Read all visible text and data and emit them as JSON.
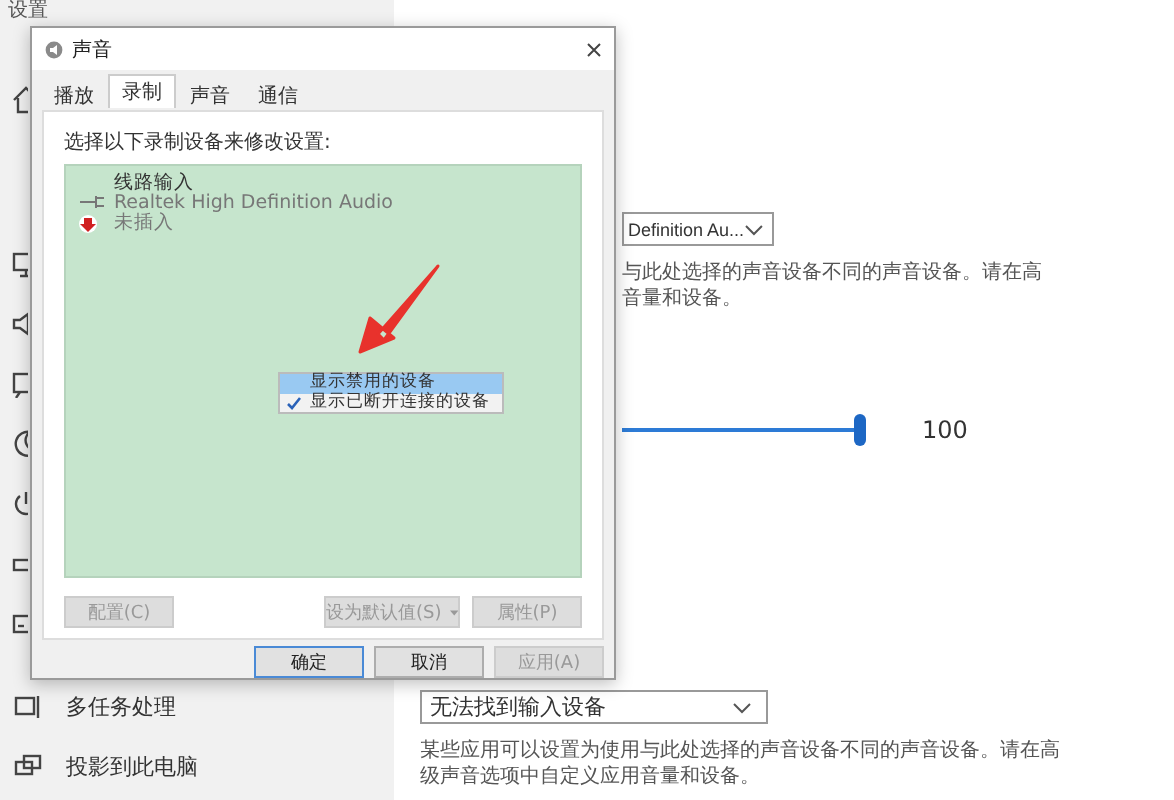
{
  "settings": {
    "title": "设置",
    "sidebar_items": [
      {
        "label": "多任务处理"
      },
      {
        "label": "投影到此电脑"
      }
    ],
    "output_device": {
      "value": "Definition Au..."
    },
    "output_note": [
      "与此处选择的声音设备不同的声音设备。请在高",
      "音量和设备。"
    ],
    "volume": {
      "level": 1,
      "reading": "100"
    },
    "input_device": {
      "value": "无法找到输入设备"
    },
    "input_note": [
      "某些应用可以设置为使用与此处选择的声音设备不同的声音设备。请在高",
      "级声音选项中自定义应用音量和设备。"
    ]
  },
  "dialog": {
    "title": "声音",
    "tabs": [
      {
        "label": "播放",
        "selected": false
      },
      {
        "label": "录制",
        "selected": true
      },
      {
        "label": "声音",
        "selected": false
      },
      {
        "label": "通信",
        "selected": false
      }
    ],
    "instruction": "选择以下录制设备来修改设置:",
    "devices": [
      {
        "name": "线路输入",
        "driver": "Realtek High Definition Audio",
        "status": "未插入"
      }
    ],
    "context_menu": [
      {
        "label": "显示禁用的设备",
        "selected": true,
        "checked": false
      },
      {
        "label": "显示已断开连接的设备",
        "selected": false,
        "checked": true
      }
    ],
    "device_buttons": [
      {
        "label": "配置(C)",
        "disabled": true,
        "kind": "button"
      },
      {
        "label": "设为默认值(S)",
        "disabled": true,
        "kind": "split"
      },
      {
        "label": "属性(P)",
        "disabled": true,
        "kind": "button"
      }
    ],
    "buttons": [
      {
        "label": "确定",
        "disabled": false,
        "default": true
      },
      {
        "label": "取消",
        "disabled": false,
        "default": false
      },
      {
        "label": "应用(A)",
        "disabled": true,
        "default": false
      }
    ]
  }
}
